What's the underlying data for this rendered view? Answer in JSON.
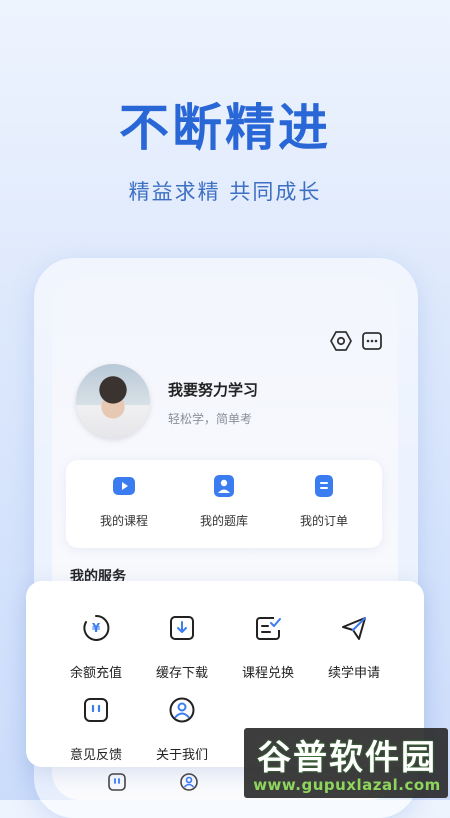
{
  "hero": {
    "headline": "不断精进",
    "tagline": "精益求精   共同成长"
  },
  "profile": {
    "username": "我要努力学习",
    "subtitle": "轻松学，简单考"
  },
  "header_icons": [
    "settings-hex-icon",
    "more-menu-icon"
  ],
  "quick_links": [
    {
      "label": "我的课程",
      "icon": "course-play-icon"
    },
    {
      "label": "我的题库",
      "icon": "question-bank-icon"
    },
    {
      "label": "我的订单",
      "icon": "order-icon"
    }
  ],
  "services": {
    "title": "我的服务",
    "items": [
      {
        "label": "余额充值",
        "icon": "recharge-yen-icon"
      },
      {
        "label": "缓存下载",
        "icon": "download-icon"
      },
      {
        "label": "课程兑换",
        "icon": "redeem-icon"
      },
      {
        "label": "续学申请",
        "icon": "send-icon"
      },
      {
        "label": "意见反馈",
        "icon": "feedback-icon"
      },
      {
        "label": "关于我们",
        "icon": "about-user-icon"
      }
    ]
  },
  "watermark": {
    "title": "谷普软件园",
    "url": "www.gupuxlazal.com"
  },
  "colors": {
    "brand_blue": "#2a67d6",
    "accent_blue": "#3b7cf0",
    "watermark_green": "#8ed65b"
  }
}
